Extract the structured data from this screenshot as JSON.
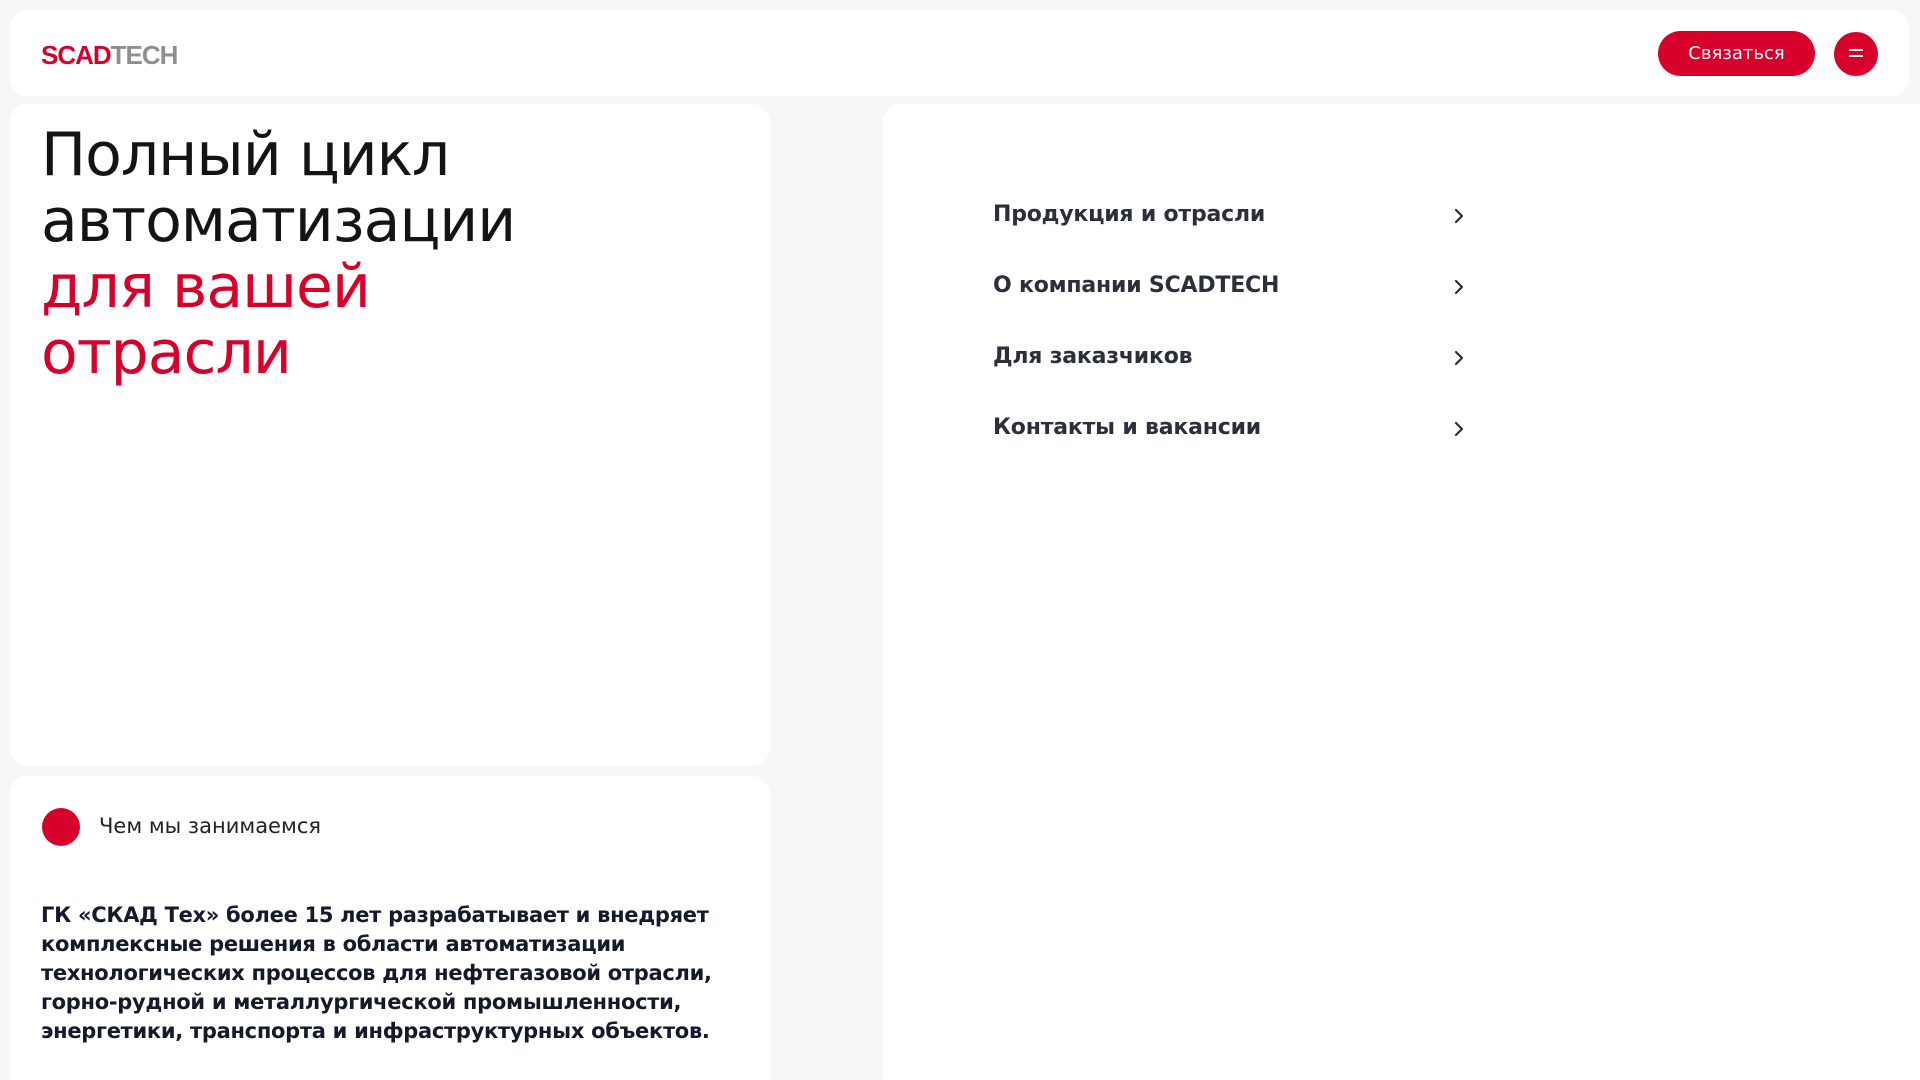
{
  "header": {
    "logo_part1": "SCAD",
    "logo_part2": "TECH",
    "contact_label": "Связаться",
    "menu_icon": "hamburger-icon"
  },
  "hero": {
    "title_lines": [
      "Полный цикл",
      "автоматизации"
    ],
    "accent_lines": [
      "для вашей",
      "отрасли"
    ]
  },
  "about": {
    "label": "Чем мы занимаемся",
    "text": "ГК «СКАД Тех» более 15 лет разрабатывает и внедряет комплексные решения в области автоматизации технологических процессов для нефтегазовой отрасли, горно-рудной и металлургической промышленности, энергетики, транспорта и инфраструктурных объектов."
  },
  "nav": {
    "items": [
      {
        "label": "Продукция и отрасли"
      },
      {
        "label": "О компании SCADTECH"
      },
      {
        "label": "Для заказчиков"
      },
      {
        "label": "Контакты и вакансии"
      }
    ]
  },
  "colors": {
    "accent": "#d6002a",
    "background": "#f6f7f9",
    "text": "#141414"
  }
}
